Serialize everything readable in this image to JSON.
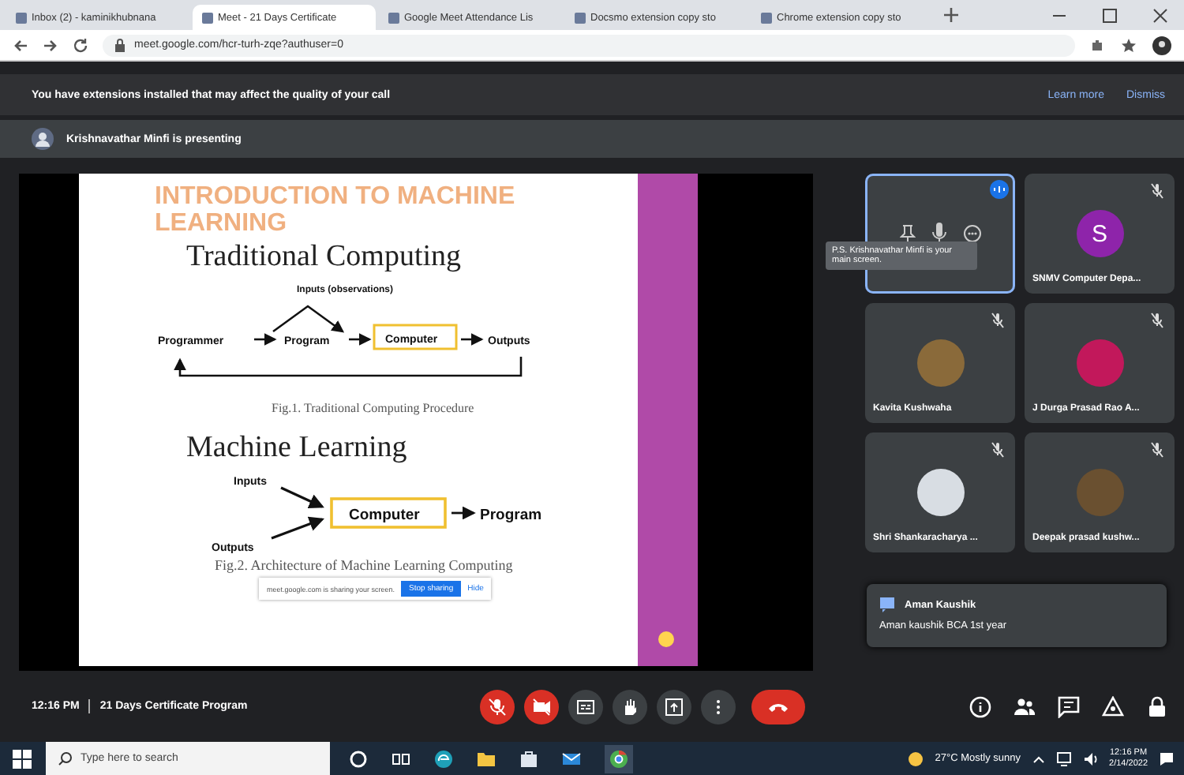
{
  "browser": {
    "tabs": [
      {
        "title": "Inbox (2) - kaminikhubnana",
        "selected": false
      },
      {
        "title": "Meet - 21 Days Certificate",
        "selected": true
      },
      {
        "title": "Google Meet Attendance Lis",
        "selected": false
      },
      {
        "title": "Docsmo extension copy sto",
        "selected": false
      },
      {
        "title": "Chrome extension copy sto",
        "selected": false
      }
    ],
    "url": "meet.google.com/hcr-turh-zqe?authuser=0"
  },
  "banner": {
    "message": "You have extensions installed that may affect the quality of your call",
    "actions": [
      "Learn more",
      "Dismiss"
    ]
  },
  "presenting": {
    "text": "Krishnavathar Minfi is presenting"
  },
  "slide": {
    "title": "INTRODUCTION TO MACHINE LEARNING",
    "heading_1": "Traditional Computing",
    "diagram_1": {
      "inputs": "Inputs (observations)",
      "programmer": "Programmer",
      "program": "Program",
      "computer": "Computer",
      "outputs": "Outputs"
    },
    "caption_1": "Fig.1.  Traditional Computing Procedure",
    "heading_2": "Machine Learning",
    "diagram_2": {
      "inputs": "Inputs",
      "outputs": "Outputs",
      "computer": "Computer",
      "program": "Program"
    },
    "caption_2": "Fig.2. Architecture of Machine Learning Computing",
    "share_bar": {
      "text": "meet.google.com is sharing your screen.",
      "stop": "Stop sharing",
      "hide": "Hide"
    }
  },
  "tooltip": "P.S. Krishnavathar Minfi is your main screen.",
  "participants": [
    {
      "kind": "presenter",
      "speaking": true
    },
    {
      "kind": "letter",
      "letter": "S",
      "color": "#8e24aa",
      "name": "SNMV Computer Depa...",
      "muted": true
    },
    {
      "kind": "photo",
      "color": "#8a6a3a",
      "name": "Kavita Kushwaha",
      "muted": true
    },
    {
      "kind": "photo",
      "color": "#c2185b",
      "name": "J Durga Prasad Rao A...",
      "muted": true
    },
    {
      "kind": "photo",
      "color": "#d8dde3",
      "name": "Shri Shankaracharya ...",
      "muted": true
    },
    {
      "kind": "photo",
      "color": "#6a5030",
      "name": "Deepak prasad kushw...",
      "muted": true
    }
  ],
  "chat_popup": {
    "sender": "Aman Kaushik",
    "message": "Aman kaushik BCA 1st year"
  },
  "controls": {
    "time": "12:16 PM",
    "meeting_title": "21 Days Certificate Program"
  },
  "taskbar": {
    "search_placeholder": "Type here to search",
    "weather": "27°C  Mostly sunny",
    "time": "12:16 PM",
    "date": "2/14/2022"
  }
}
